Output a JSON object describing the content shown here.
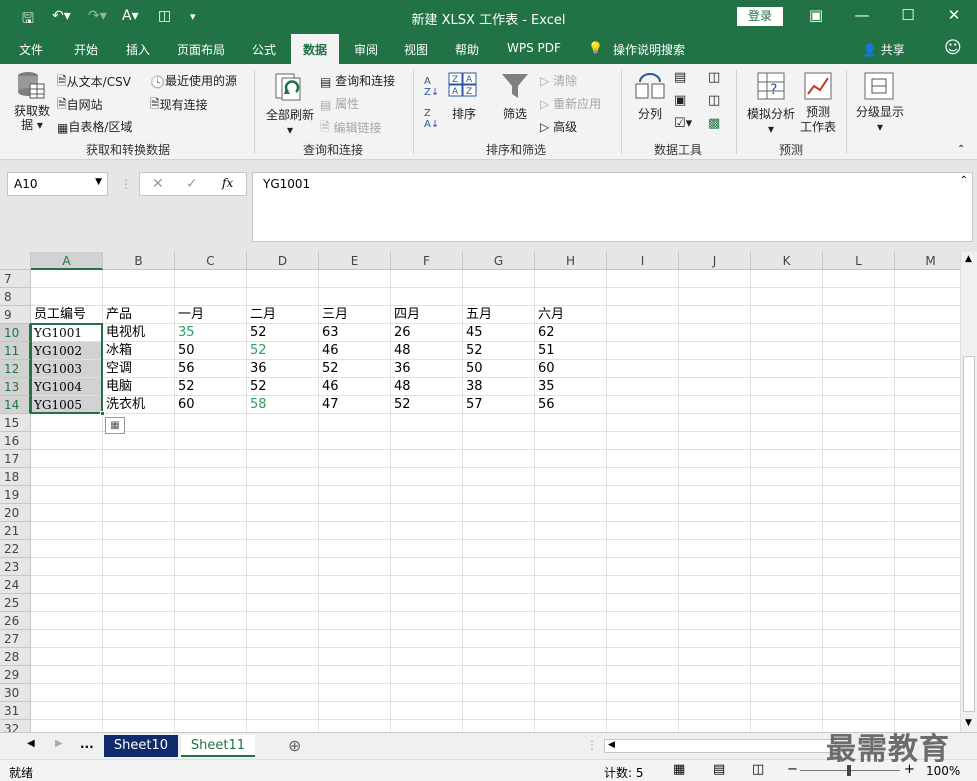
{
  "window": {
    "title": "新建 XLSX 工作表  -  Excel",
    "login": "登录"
  },
  "tabs": [
    "文件",
    "开始",
    "插入",
    "页面布局",
    "公式",
    "数据",
    "审阅",
    "视图",
    "帮助",
    "WPS PDF",
    "操作说明搜索"
  ],
  "share": "共享",
  "ribbon": {
    "get_data": "获取数据",
    "from_text": "从文本/CSV",
    "from_web": "自网站",
    "from_table": "自表格/区域",
    "recent_sources": "最近使用的源",
    "existing_conn": "现有连接",
    "group1": "获取和转换数据",
    "refresh_all": "全部刷新",
    "queries_conn": "查询和连接",
    "properties": "属性",
    "edit_links": "编辑链接",
    "group2": "查询和连接",
    "sort": "排序",
    "filter": "筛选",
    "clear": "清除",
    "reapply": "重新应用",
    "advanced": "高级",
    "group3": "排序和筛选",
    "split": "分列",
    "group4": "数据工具",
    "whatif": "模拟分析",
    "forecast": "预测",
    "forecast_sheet": "工作表",
    "group5": "预测",
    "outline": "分级显示"
  },
  "formula_bar": {
    "name_box": "A10",
    "fx": "fx",
    "value": "YG1001"
  },
  "columns": [
    "A",
    "B",
    "C",
    "D",
    "E",
    "F",
    "G",
    "H",
    "I",
    "J",
    "K",
    "L",
    "M"
  ],
  "rows": [
    [
      "7",
      "",
      "",
      "",
      "",
      "",
      "",
      "",
      ""
    ],
    [
      "8",
      "",
      "",
      "",
      "",
      "",
      "",
      "",
      ""
    ],
    [
      "9",
      "员工编号",
      "产品",
      "一月",
      "二月",
      "三月",
      "四月",
      "五月",
      "六月"
    ],
    [
      "10",
      "YG1001",
      "电视机",
      "35",
      "52",
      "63",
      "26",
      "45",
      "62"
    ],
    [
      "11",
      "YG1002",
      "冰箱",
      "50",
      "52",
      "46",
      "48",
      "52",
      "51"
    ],
    [
      "12",
      "YG1003",
      "空调",
      "56",
      "36",
      "52",
      "36",
      "50",
      "60"
    ],
    [
      "13",
      "YG1004",
      "电脑",
      "52",
      "52",
      "46",
      "48",
      "38",
      "35"
    ],
    [
      "14",
      "YG1005",
      "洗衣机",
      "60",
      "58",
      "47",
      "52",
      "57",
      "56"
    ],
    [
      "15"
    ],
    [
      "16"
    ],
    [
      "17"
    ],
    [
      "18"
    ],
    [
      "19"
    ],
    [
      "20"
    ],
    [
      "21"
    ],
    [
      "22"
    ],
    [
      "23"
    ],
    [
      "24"
    ],
    [
      "25"
    ],
    [
      "26"
    ],
    [
      "27"
    ],
    [
      "28"
    ],
    [
      "29"
    ],
    [
      "30"
    ],
    [
      "31"
    ],
    [
      "32"
    ]
  ],
  "green_cells": [
    "10-3",
    "11-4",
    "14-4"
  ],
  "sheets": {
    "sheet10": "Sheet10",
    "sheet11": "Sheet11",
    "more": "..."
  },
  "status": {
    "ready": "就绪",
    "count": "计数: 5",
    "zoom": "100%"
  },
  "watermark": "最需教育"
}
